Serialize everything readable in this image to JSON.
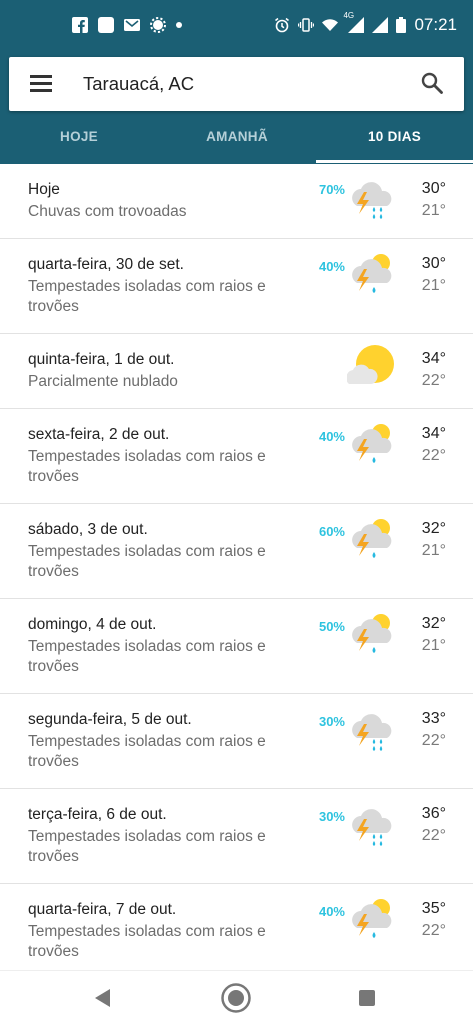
{
  "status_bar": {
    "time": "07:21",
    "network": "4G",
    "left_icons": [
      "facebook-icon",
      "app-square-icon",
      "gmail-icon",
      "settings-gear-icon",
      "dot-icon"
    ],
    "right_icons": [
      "alarm-icon",
      "vibrate-icon",
      "wifi-icon",
      "signal-icon",
      "signal-icon",
      "battery-icon"
    ]
  },
  "search": {
    "location": "Tarauacá, AC"
  },
  "tabs": [
    "HOJE",
    "AMANHÃ",
    "10 DIAS"
  ],
  "active_tab": "10 DIAS",
  "colors": {
    "header": "#1b5f74",
    "precip": "#2ec3df",
    "sun": "#ffd22e",
    "bolt": "#f4a522",
    "rain": "#26b9e0",
    "cloud": "#d9d9d9"
  },
  "forecast": [
    {
      "day": "Hoje",
      "condition": "Chuvas com trovoadas",
      "precip": "70%",
      "icon": "thunderstorm-icon",
      "high": "30°",
      "low": "21°"
    },
    {
      "day": "quarta-feira, 30 de set.",
      "condition": "Tempestades isoladas com raios e trovões",
      "precip": "40%",
      "icon": "isolated-thunderstorm-icon",
      "high": "30°",
      "low": "21°"
    },
    {
      "day": "quinta-feira, 1 de out.",
      "condition": "Parcialmente nublado",
      "precip": "",
      "icon": "partly-cloudy-icon",
      "high": "34°",
      "low": "22°"
    },
    {
      "day": "sexta-feira, 2 de out.",
      "condition": "Tempestades isoladas com raios e trovões",
      "precip": "40%",
      "icon": "isolated-thunderstorm-icon",
      "high": "34°",
      "low": "22°"
    },
    {
      "day": "sábado, 3 de out.",
      "condition": "Tempestades isoladas com raios e trovões",
      "precip": "60%",
      "icon": "isolated-thunderstorm-icon",
      "high": "32°",
      "low": "21°"
    },
    {
      "day": "domingo, 4 de out.",
      "condition": "Tempestades isoladas com raios e trovões",
      "precip": "50%",
      "icon": "isolated-thunderstorm-icon",
      "high": "32°",
      "low": "21°"
    },
    {
      "day": "segunda-feira, 5 de out.",
      "condition": "Tempestades isoladas com raios e trovões",
      "precip": "30%",
      "icon": "thunderstorm-icon",
      "high": "33°",
      "low": "22°"
    },
    {
      "day": "terça-feira, 6 de out.",
      "condition": "Tempestades isoladas com raios e trovões",
      "precip": "30%",
      "icon": "thunderstorm-icon",
      "high": "36°",
      "low": "22°"
    },
    {
      "day": "quarta-feira, 7 de out.",
      "condition": "Tempestades isoladas com raios e trovões",
      "precip": "40%",
      "icon": "isolated-thunderstorm-icon",
      "high": "35°",
      "low": "22°"
    }
  ]
}
